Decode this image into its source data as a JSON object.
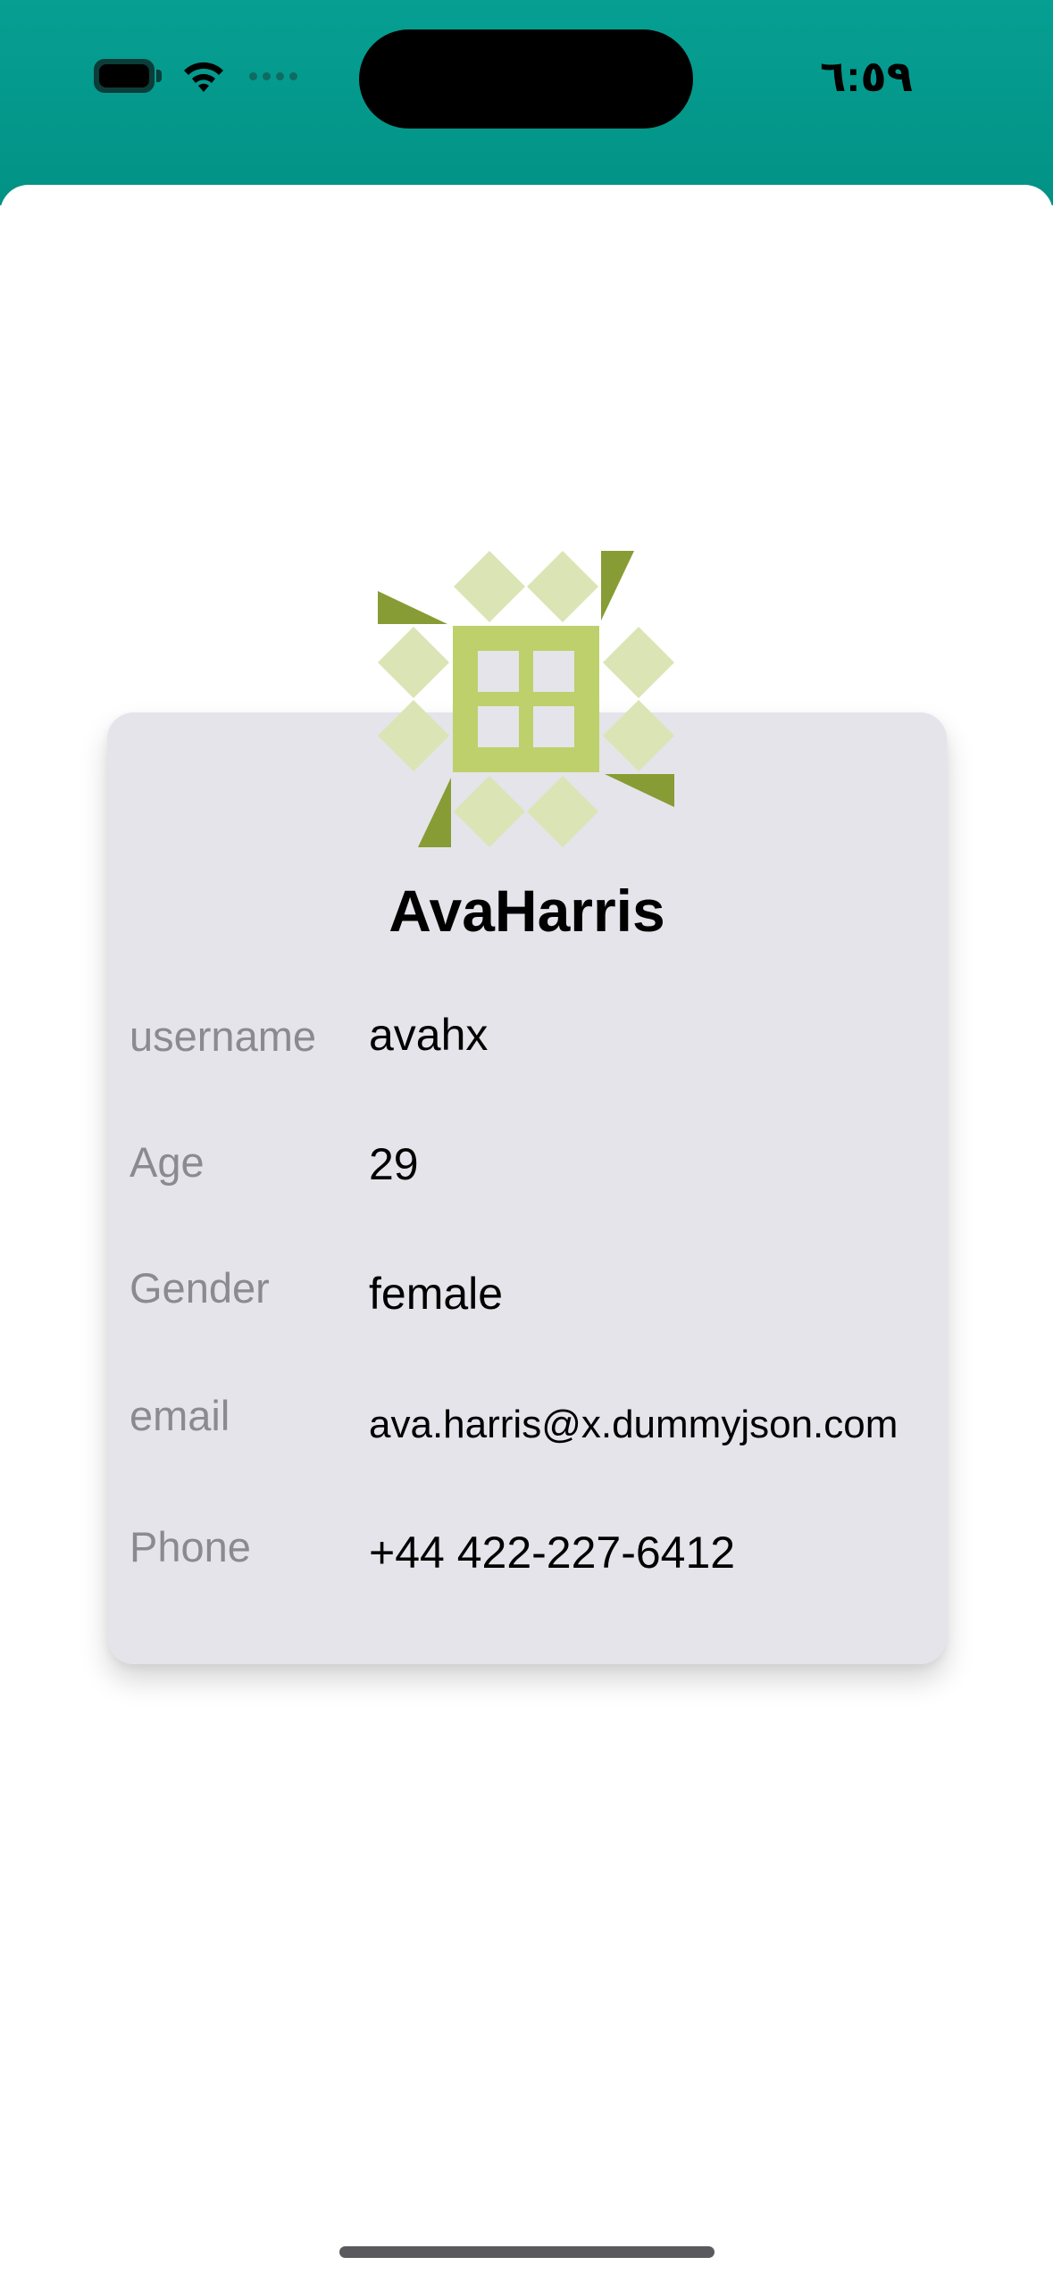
{
  "status_bar": {
    "time": "٦:٥٩",
    "icons": [
      "battery-icon",
      "wifi-icon",
      "signal-dots-icon"
    ],
    "background_color": "#019285"
  },
  "profile": {
    "name": "AvaHarris",
    "avatar_icon": "identicon-avatar",
    "rows": [
      {
        "label": "username",
        "value": "avahx"
      },
      {
        "label": "Age",
        "value": "29"
      },
      {
        "label": "Gender",
        "value": "female"
      },
      {
        "label": "email",
        "value": "ava.harris@x.dummyjson.com"
      },
      {
        "label": "Phone",
        "value": "+44 422-227-6412"
      }
    ]
  },
  "colors": {
    "card_background": "#e5e4ea",
    "label_color": "#8a8a8f",
    "avatar_light": "#dbe4b4",
    "avatar_mid": "#bdd06c",
    "avatar_dark": "#879c34"
  }
}
